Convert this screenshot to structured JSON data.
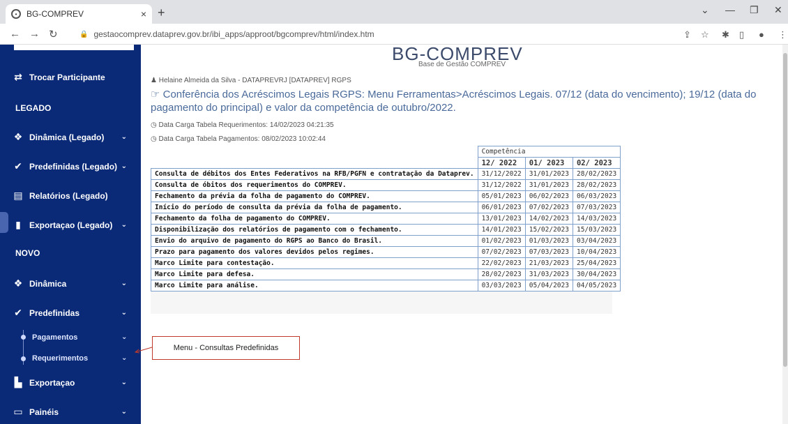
{
  "browser": {
    "tab_title": "BG-COMPREV",
    "tab_close": "×",
    "new_tab": "+",
    "url": "gestaocomprev.dataprev.gov.br/ibi_apps/approot/bgcomprev/html/index.htm"
  },
  "sidebar": {
    "items": [
      {
        "label": "Trocar Participante",
        "icon": "swap-icon"
      },
      {
        "label": "LEGADO",
        "type": "section"
      },
      {
        "label": "Dinâmica (Legado)",
        "icon": "cubes-icon"
      },
      {
        "label": "Predefinidas (Legado)",
        "icon": "check-icon"
      },
      {
        "label": "Relatórios (Legado)",
        "icon": "document-icon"
      },
      {
        "label": "Exportaçao (Legado)",
        "icon": "export-icon"
      },
      {
        "label": "NOVO",
        "type": "section"
      },
      {
        "label": "Dinâmica",
        "icon": "cubes-icon"
      },
      {
        "label": "Predefinidas",
        "icon": "check-icon"
      },
      {
        "label": "Pagamentos",
        "type": "sub"
      },
      {
        "label": "Requerimentos",
        "type": "sub"
      },
      {
        "label": "Exportaçao",
        "icon": "file-icon"
      },
      {
        "label": "Painéis",
        "icon": "monitor-icon"
      }
    ]
  },
  "main": {
    "brand": "BG-COMPREV",
    "brand_subtitle": "Base de Gestão COMPREV",
    "user": "Helaine Almeida da Silva - DATAPREVRJ [DATAPREV] RGPS",
    "notice": "Conferência dos Acréscimos Legais RGPS: Menu Ferramentas>Acréscimos Legais. 07/12 (data do vencimento); 19/12 (data do pagamento do principal) e valor da competência de outubro/2022.",
    "carga_requerimentos": "Data Carga Tabela Requerimentos: 14/02/2023 04:21:35",
    "carga_pagamentos": "Data Carga Tabela Pagamentos: 08/02/2023 10:02:44",
    "table": {
      "group_header": "Competência",
      "months": [
        "12/ 2022",
        "01/ 2023",
        "02/ 2023"
      ],
      "rows": [
        {
          "desc": "Consulta de débitos dos Entes Federativos na RFB/PGFN e contratação da Dataprev.",
          "vals": [
            "31/12/2022",
            "31/01/2023",
            "28/02/2023"
          ]
        },
        {
          "desc": "Consulta de óbitos dos requerimentos do COMPREV.",
          "vals": [
            "31/12/2022",
            "31/01/2023",
            "28/02/2023"
          ]
        },
        {
          "desc": "Fechamento da prévia da folha de pagamento do COMPREV.",
          "vals": [
            "05/01/2023",
            "06/02/2023",
            "06/03/2023"
          ]
        },
        {
          "desc": "Início do período de consulta da prévia da folha de pagamento.",
          "vals": [
            "06/01/2023",
            "07/02/2023",
            "07/03/2023"
          ]
        },
        {
          "desc": "Fechamento da folha de pagamento do COMPREV.",
          "vals": [
            "13/01/2023",
            "14/02/2023",
            "14/03/2023"
          ]
        },
        {
          "desc": "Disponibilização dos relatórios de pagamento com o fechamento.",
          "vals": [
            "14/01/2023",
            "15/02/2023",
            "15/03/2023"
          ]
        },
        {
          "desc": "Envio do arquivo de pagamento do RGPS ao Banco do Brasil.",
          "vals": [
            "01/02/2023",
            "01/03/2023",
            "03/04/2023"
          ]
        },
        {
          "desc": "Prazo para pagamento dos valores devidos pelos regimes.",
          "vals": [
            "07/02/2023",
            "07/03/2023",
            "10/04/2023"
          ]
        },
        {
          "desc": "Marco Limite para contestação.",
          "vals": [
            "22/02/2023",
            "21/03/2023",
            "25/04/2023"
          ]
        },
        {
          "desc": "Marco Limite para defesa.",
          "vals": [
            "28/02/2023",
            "31/03/2023",
            "30/04/2023"
          ]
        },
        {
          "desc": "Marco Limite para análise.",
          "vals": [
            "03/03/2023",
            "05/04/2023",
            "04/05/2023"
          ]
        }
      ]
    }
  },
  "callout": {
    "label": "Menu - Consultas Predefinidas"
  },
  "colors": {
    "sidebar_bg": "#0a2a78",
    "notice_text": "#4a6a9a",
    "table_border": "#7fa0cc",
    "callout_border": "#c0392b"
  }
}
